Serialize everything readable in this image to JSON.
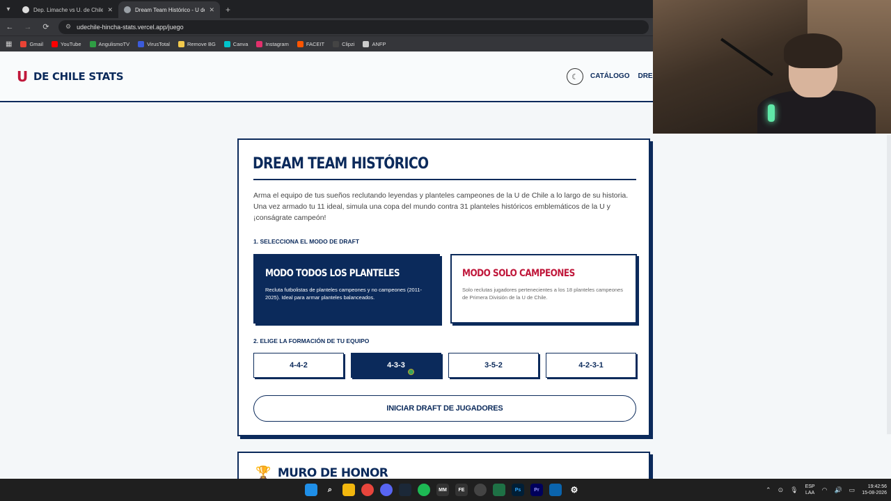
{
  "browser": {
    "tabs": [
      {
        "title": "Dep. Limache vs U. de Chile • Hi"
      },
      {
        "title": "Dream Team Histórico - U de Ch"
      }
    ],
    "url": "udechile-hincha-stats.vercel.app/juego",
    "bookmarks": [
      {
        "label": "Gmail",
        "color": "#ea4335"
      },
      {
        "label": "YouTube",
        "color": "#ff0000"
      },
      {
        "label": "AngulismoTV",
        "color": "#2f9e44"
      },
      {
        "label": "VirusTotal",
        "color": "#3b5bdb"
      },
      {
        "label": "Remove BG",
        "color": "#f2c94c"
      },
      {
        "label": "Canva",
        "color": "#00c4cc"
      },
      {
        "label": "Instagram",
        "color": "#e1306c"
      },
      {
        "label": "FACEIT",
        "color": "#ff5500"
      },
      {
        "label": "Clipzi",
        "color": "#444444"
      },
      {
        "label": "ANFP",
        "color": "#cccccc"
      }
    ]
  },
  "site": {
    "logo_mark": "U",
    "logo_text": "DE CHILE STATS",
    "nav": [
      "CATÁLOGO",
      "DREA"
    ]
  },
  "game": {
    "title": "DREAM TEAM HISTÓRICO",
    "intro": "Arma el equipo de tus sueños reclutando leyendas y planteles campeones de la U de Chile a lo largo de su historia. Una vez armado tu 11 ideal, simula una copa del mundo contra 31 planteles históricos emblemáticos de la U y ¡conságrate campeón!",
    "step1": "1. SELECCIONA EL MODO DE DRAFT",
    "modes": [
      {
        "title": "MODO TODOS LOS PLANTELES",
        "desc": "Recluta futbolistas de planteles campeones y no campeones (2011-2025). Ideal para armar planteles balanceados.",
        "selected": true
      },
      {
        "title": "MODO SOLO CAMPEONES",
        "desc": "Solo reclutas jugadores pertenecientes a los 18 planteles campeones de Primera División de la U de Chile.",
        "selected": false
      }
    ],
    "step2": "2. ELIGE LA FORMACIÓN DE TU EQUIPO",
    "formations": [
      {
        "label": "4-4-2",
        "selected": false
      },
      {
        "label": "4-3-3",
        "selected": true
      },
      {
        "label": "3-5-2",
        "selected": false
      },
      {
        "label": "4-2-3-1",
        "selected": false
      }
    ],
    "start_label": "INICIAR DRAFT DE JUGADORES"
  },
  "honor": {
    "title": "MURO DE HONOR"
  },
  "taskbar": {
    "lang_top": "ESP",
    "lang_bottom": "LAA",
    "time": "19:42:56",
    "date": "15-08-2026"
  },
  "colors": {
    "navy": "#0b2a5b",
    "red": "#c0183b"
  }
}
